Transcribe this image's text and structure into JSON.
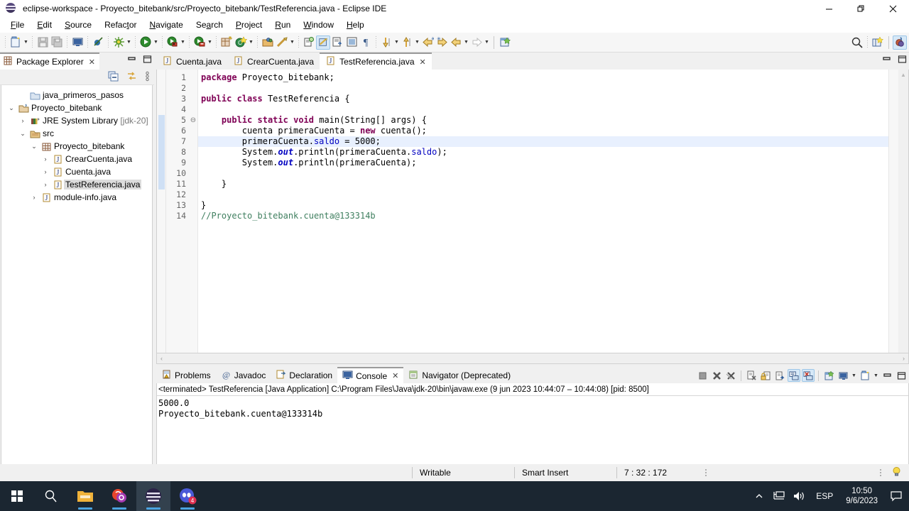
{
  "window": {
    "title": "eclipse-workspace - Proyecto_bitebank/src/Proyecto_bitebank/TestReferencia.java - Eclipse IDE",
    "icon": "eclipse-icon",
    "controls": {
      "minimize": "minimize-icon",
      "maximize": "restore-icon",
      "close": "close-icon"
    }
  },
  "menubar": {
    "items": [
      {
        "label": "File",
        "mnemonic": "F"
      },
      {
        "label": "Edit",
        "mnemonic": "E"
      },
      {
        "label": "Source",
        "mnemonic": "S"
      },
      {
        "label": "Refactor",
        "mnemonic": "t"
      },
      {
        "label": "Navigate",
        "mnemonic": "N"
      },
      {
        "label": "Search",
        "mnemonic": "a"
      },
      {
        "label": "Project",
        "mnemonic": "P"
      },
      {
        "label": "Run",
        "mnemonic": "R"
      },
      {
        "label": "Window",
        "mnemonic": "W"
      },
      {
        "label": "Help",
        "mnemonic": "H"
      }
    ]
  },
  "toolbar": {
    "items": [
      "new-wizard-icon",
      "save-icon",
      "save-all-icon",
      "print-icon",
      "new-java-project-icon",
      "debug-icon",
      "run-icon",
      "run-external-tools-icon",
      "coverage-icon",
      "new-java-class-icon",
      "new-annotation-icon",
      "open-type-icon",
      "search-icon",
      "toggle-mark-occurrences-icon",
      "skip-all-breakpoints-icon",
      "show-whitespace-icon",
      "pilcrow-icon",
      "next-annotation-icon",
      "previous-annotation-icon",
      "last-edit-location-icon",
      "back-icon",
      "forward-icon",
      "open-perspective-icon",
      "java-perspective-icon"
    ]
  },
  "explorer": {
    "tab_label": "Package Explorer",
    "tab_icon": "package-explorer-icon",
    "view_controls": [
      "minimize-view-icon",
      "maximize-view-icon"
    ],
    "toolbar": [
      "collapse-all-icon",
      "link-with-editor-icon",
      "view-menu-icon"
    ],
    "tree": [
      {
        "label": "java_primeros_pasos",
        "icon": "closed-project-icon",
        "indent": 1,
        "twisty": "",
        "selected": false
      },
      {
        "label": "Proyecto_bitebank",
        "icon": "java-project-icon",
        "indent": 0,
        "twisty": "open",
        "selected": false
      },
      {
        "label": "JRE System Library",
        "suffix": "[jdk-20]",
        "icon": "library-icon",
        "indent": 1,
        "twisty": "closed",
        "selected": false
      },
      {
        "label": "src",
        "icon": "source-folder-icon",
        "indent": 1,
        "twisty": "open",
        "selected": false
      },
      {
        "label": "Proyecto_bitebank",
        "icon": "package-icon",
        "indent": 2,
        "twisty": "open",
        "selected": false
      },
      {
        "label": "CrearCuenta.java",
        "icon": "java-file-icon",
        "indent": 3,
        "twisty": "closed",
        "selected": false
      },
      {
        "label": "Cuenta.java",
        "icon": "java-file-icon",
        "indent": 3,
        "twisty": "closed",
        "selected": false
      },
      {
        "label": "TestReferencia.java",
        "icon": "java-file-icon",
        "indent": 3,
        "twisty": "closed",
        "selected": true
      },
      {
        "label": "module-info.java",
        "icon": "java-file-icon",
        "indent": 2,
        "twisty": "closed",
        "selected": false
      }
    ]
  },
  "editor": {
    "tabs": [
      {
        "label": "Cuenta.java",
        "icon": "java-file-icon",
        "active": false,
        "closable": false
      },
      {
        "label": "CrearCuenta.java",
        "icon": "java-file-icon",
        "active": false,
        "closable": false
      },
      {
        "label": "TestReferencia.java",
        "icon": "java-file-icon",
        "active": true,
        "closable": true
      }
    ],
    "view_controls": [
      "minimize-editor-icon",
      "maximize-editor-icon"
    ],
    "highlighted_line": 7,
    "lines": [
      {
        "n": 1,
        "text": "package Proyecto_bitebank;"
      },
      {
        "n": 2,
        "text": ""
      },
      {
        "n": 3,
        "text": "public class TestReferencia {"
      },
      {
        "n": 4,
        "text": ""
      },
      {
        "n": 5,
        "text": "    public static void main(String[] args) {"
      },
      {
        "n": 6,
        "text": "        cuenta primeraCuenta = new cuenta();"
      },
      {
        "n": 7,
        "text": "        primeraCuenta.saldo = 5000;"
      },
      {
        "n": 8,
        "text": "        System.out.println(primeraCuenta.saldo);"
      },
      {
        "n": 9,
        "text": "        System.out.println(primeraCuenta);"
      },
      {
        "n": 10,
        "text": ""
      },
      {
        "n": 11,
        "text": "    }"
      },
      {
        "n": 12,
        "text": ""
      },
      {
        "n": 13,
        "text": "}"
      },
      {
        "n": 14,
        "text": "//Proyecto_bitebank.cuenta@133314b"
      }
    ],
    "scroll_left_arrow": "‹",
    "scroll_right_arrow": "›"
  },
  "bottom_panel": {
    "tabs": [
      {
        "label": "Problems",
        "icon": "problems-icon",
        "active": false,
        "closable": false
      },
      {
        "label": "Javadoc",
        "icon": "javadoc-icon",
        "active": false,
        "closable": false
      },
      {
        "label": "Declaration",
        "icon": "declaration-icon",
        "active": false,
        "closable": false
      },
      {
        "label": "Console",
        "icon": "console-icon",
        "active": true,
        "closable": true
      },
      {
        "label": "Navigator (Deprecated)",
        "icon": "navigator-icon",
        "active": false,
        "closable": false
      }
    ],
    "controls": [
      "terminate-icon",
      "remove-launch-icon",
      "remove-all-terminated-icon",
      "clear-console-icon",
      "scroll-lock-icon",
      "word-wrap-icon",
      "show-console-on-output-icon",
      "show-console-on-error-icon",
      "pin-console-icon",
      "display-selected-console-icon",
      "open-console-icon",
      "minimize-panel-icon",
      "maximize-panel-icon"
    ],
    "console_header": "<terminated> TestReferencia [Java Application] C:\\Program Files\\Java\\jdk-20\\bin\\javaw.exe  (9 jun 2023 10:44:07 – 10:44:08) [pid: 8500]",
    "console_output": [
      "5000.0",
      "Proyecto_bitebank.cuenta@133314b"
    ],
    "scroll_left_arrow": "‹",
    "scroll_right_arrow": "›"
  },
  "statusbar": {
    "writable": "Writable",
    "insert_mode": "Smart Insert",
    "cursor_position": "7 : 32 : 172",
    "tip_icon": "lightbulb-icon"
  },
  "taskbar": {
    "buttons": [
      {
        "name": "start-button",
        "icon": "windows-logo-icon"
      },
      {
        "name": "search-button",
        "icon": "search-icon"
      },
      {
        "name": "file-explorer-button",
        "icon": "folder-icon"
      },
      {
        "name": "app-button",
        "icon": "colorful-app-icon"
      },
      {
        "name": "eclipse-taskbar-button",
        "icon": "eclipse-icon"
      },
      {
        "name": "discord-button",
        "icon": "discord-icon",
        "badge": "4"
      }
    ],
    "tray": {
      "show_hidden": "chevron-up-icon",
      "network": "network-icon",
      "volume": "speaker-icon",
      "language": "ESP",
      "time": "10:50",
      "date": "9/6/2023",
      "notifications": "notification-icon"
    }
  },
  "colors": {
    "keyword": "#7f0055",
    "field": "#0000c0",
    "comment": "#3f7f5f",
    "line_highlight": "#e8f0fe",
    "accent": "#d6e8f7",
    "taskbar": "#1b2631"
  }
}
